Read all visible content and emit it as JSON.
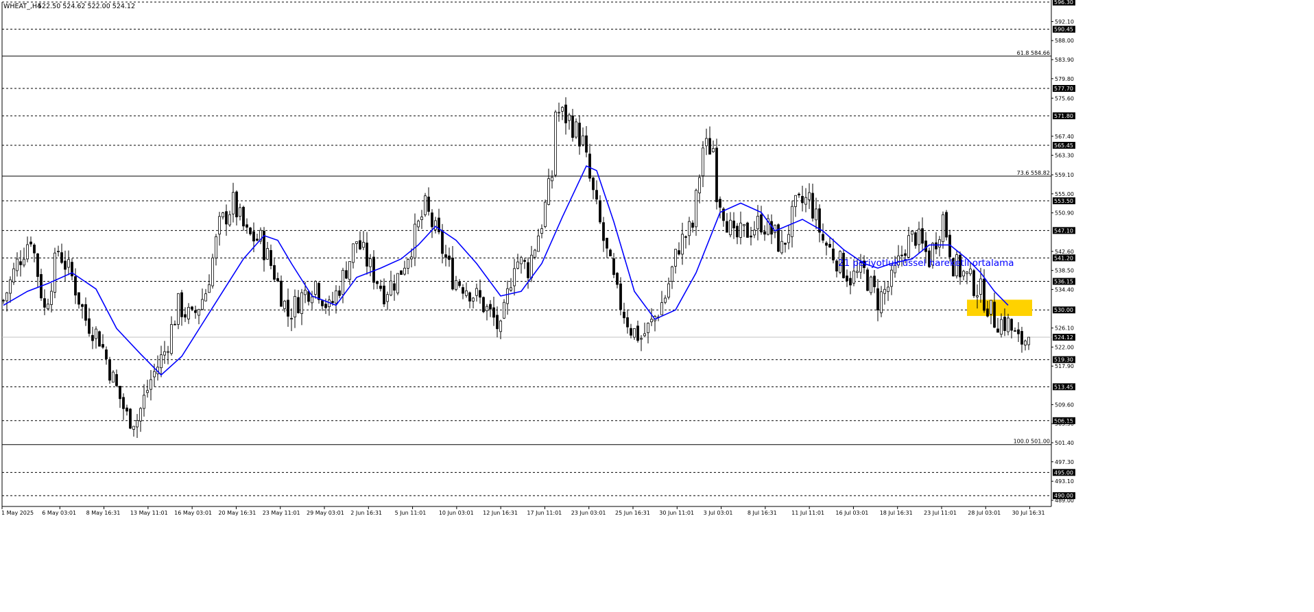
{
  "chart_header": {
    "symbol": "WHEAT_,H4",
    "ohlc": "522.50 524.62 522.00 524.12"
  },
  "annotation": "21 periyotluk üssel hareketli ortalama",
  "colors": {
    "background": "#ffffff",
    "candle": "#000000",
    "ema": "#0000ff",
    "highlight": "#ffd200",
    "annotation_text": "#0000ff"
  },
  "chart_data": {
    "type": "line",
    "subtype": "candlestick",
    "title": "",
    "xlabel": "",
    "ylabel": "",
    "ylim": [
      489.0,
      596.3
    ],
    "grid": false,
    "y_ticks": [
      "592.10",
      "588.00",
      "583.90",
      "579.80",
      "575.60",
      "567.40",
      "563.30",
      "559.10",
      "555.00",
      "550.90",
      "542.60",
      "538.50",
      "534.40",
      "526.10",
      "522.00",
      "517.90",
      "509.60",
      "505.50",
      "501.40",
      "497.30",
      "493.10",
      "489.00"
    ],
    "x_ticks": [
      "1 May 2025",
      "6 May 03:01",
      "8 May 16:31",
      "13 May 11:01",
      "16 May 03:01",
      "20 May 16:31",
      "23 May 11:01",
      "29 May 03:01",
      "2 Jun 16:31",
      "5 Jun 11:01",
      "10 Jun 03:01",
      "12 Jun 16:31",
      "17 Jun 11:01",
      "23 Jun 03:01",
      "25 Jun 16:31",
      "30 Jun 11:01",
      "3 Jul 03:01",
      "8 Jul 16:31",
      "11 Jul 11:01",
      "16 Jul 03:01",
      "18 Jul 16:31",
      "23 Jul 11:01",
      "28 Jul 03:01",
      "30 Jul 16:31"
    ],
    "horizontal_levels": [
      {
        "value": 596.3,
        "label": "596.30",
        "style": "dashed"
      },
      {
        "value": 590.45,
        "label": "590.45",
        "style": "dashed"
      },
      {
        "value": 584.66,
        "label": "61.8 584.66",
        "style": "solid",
        "fib": true
      },
      {
        "value": 577.7,
        "label": "577.70",
        "style": "dashed"
      },
      {
        "value": 571.8,
        "label": "571.80",
        "style": "dashed"
      },
      {
        "value": 565.45,
        "label": "565.45",
        "style": "dashed"
      },
      {
        "value": 558.82,
        "label": "73.6 558.82",
        "style": "solid",
        "fib": true
      },
      {
        "value": 553.5,
        "label": "553.50",
        "style": "dashed"
      },
      {
        "value": 547.1,
        "label": "547.10",
        "style": "dashed"
      },
      {
        "value": 541.2,
        "label": "541.20",
        "style": "dashed"
      },
      {
        "value": 536.15,
        "label": "536.15",
        "style": "dashed"
      },
      {
        "value": 530.0,
        "label": "530.00",
        "style": "dashed"
      },
      {
        "value": 524.12,
        "label": "524.12",
        "style": "current"
      },
      {
        "value": 519.3,
        "label": "519.30",
        "style": "dashed"
      },
      {
        "value": 513.45,
        "label": "513.45",
        "style": "dashed"
      },
      {
        "value": 506.15,
        "label": "506.15",
        "style": "dashed"
      },
      {
        "value": 501.0,
        "label": "100.0 501.00",
        "style": "solid",
        "fib": true
      },
      {
        "value": 495.0,
        "label": "495.00",
        "style": "dashed"
      },
      {
        "value": 490.0,
        "label": "490.00",
        "style": "dashed"
      }
    ],
    "highlight_zone": {
      "y_from": 528.7,
      "y_to": 532.2,
      "x_from_bar": 281,
      "x_to_bar": 300
    },
    "price_path": [
      [
        0,
        532
      ],
      [
        4,
        540
      ],
      [
        8,
        546
      ],
      [
        12,
        530
      ],
      [
        16,
        543
      ],
      [
        20,
        537
      ],
      [
        24,
        528
      ],
      [
        28,
        524
      ],
      [
        32,
        515
      ],
      [
        36,
        507
      ],
      [
        39,
        506.5
      ],
      [
        43,
        515
      ],
      [
        47,
        521
      ],
      [
        51,
        531
      ],
      [
        55,
        528
      ],
      [
        59,
        534
      ],
      [
        63,
        548
      ],
      [
        67,
        553
      ],
      [
        71,
        546
      ],
      [
        75,
        545
      ],
      [
        79,
        538
      ],
      [
        83,
        529
      ],
      [
        87,
        533
      ],
      [
        91,
        536
      ],
      [
        95,
        530
      ],
      [
        99,
        537
      ],
      [
        103,
        545
      ],
      [
        107,
        539
      ],
      [
        111,
        534
      ],
      [
        115,
        537
      ],
      [
        119,
        544
      ],
      [
        123,
        552
      ],
      [
        127,
        545
      ],
      [
        131,
        537
      ],
      [
        135,
        535
      ],
      [
        139,
        532
      ],
      [
        143,
        528
      ],
      [
        145,
        525
      ],
      [
        149,
        541
      ],
      [
        153,
        539
      ],
      [
        157,
        549
      ],
      [
        160,
        559
      ],
      [
        161,
        573
      ],
      [
        165,
        571
      ],
      [
        169,
        566
      ],
      [
        171,
        558
      ],
      [
        175,
        545
      ],
      [
        179,
        533
      ],
      [
        183,
        526
      ],
      [
        186,
        524
      ],
      [
        189,
        527
      ],
      [
        193,
        533
      ],
      [
        197,
        544
      ],
      [
        201,
        548
      ],
      [
        204,
        565
      ],
      [
        207,
        565
      ],
      [
        208,
        556
      ],
      [
        213,
        545
      ],
      [
        217,
        547
      ],
      [
        221,
        549
      ],
      [
        225,
        546
      ],
      [
        227,
        543
      ],
      [
        231,
        552
      ],
      [
        235,
        554
      ],
      [
        239,
        545
      ],
      [
        243,
        541
      ],
      [
        247,
        537
      ],
      [
        251,
        538
      ],
      [
        255,
        532
      ],
      [
        259,
        536
      ],
      [
        263,
        544
      ],
      [
        266,
        546
      ],
      [
        270,
        541
      ],
      [
        274,
        550
      ],
      [
        277,
        540
      ],
      [
        281,
        537
      ],
      [
        285,
        534
      ],
      [
        289,
        528
      ],
      [
        293,
        527
      ],
      [
        296,
        523
      ],
      [
        299,
        524.12
      ]
    ],
    "ema_path": [
      [
        0,
        531
      ],
      [
        7,
        534
      ],
      [
        13,
        535.7
      ],
      [
        20,
        538
      ],
      [
        27,
        534.5
      ],
      [
        33,
        526
      ],
      [
        40,
        520.5
      ],
      [
        46,
        516
      ],
      [
        52,
        520
      ],
      [
        58,
        527
      ],
      [
        64,
        534
      ],
      [
        70,
        541
      ],
      [
        76,
        546
      ],
      [
        80,
        545
      ],
      [
        84,
        540
      ],
      [
        90,
        533
      ],
      [
        97,
        531
      ],
      [
        103,
        537
      ],
      [
        110,
        539
      ],
      [
        116,
        541
      ],
      [
        121,
        544
      ],
      [
        126,
        548
      ],
      [
        132,
        545
      ],
      [
        138,
        540
      ],
      [
        145,
        533
      ],
      [
        151,
        534
      ],
      [
        157,
        540
      ],
      [
        163,
        550
      ],
      [
        170,
        561
      ],
      [
        173,
        560
      ],
      [
        178,
        549
      ],
      [
        184,
        534
      ],
      [
        190,
        528
      ],
      [
        196,
        530
      ],
      [
        202,
        538
      ],
      [
        209,
        551
      ],
      [
        215,
        553
      ],
      [
        221,
        551
      ],
      [
        225,
        547
      ],
      [
        233,
        549.5
      ],
      [
        239,
        547
      ],
      [
        245,
        543
      ],
      [
        251,
        540
      ],
      [
        255,
        539
      ],
      [
        259,
        540
      ],
      [
        265,
        541
      ],
      [
        270,
        544
      ],
      [
        276,
        544
      ],
      [
        281,
        541
      ],
      [
        285,
        538
      ],
      [
        289,
        534
      ],
      [
        293,
        531
      ]
    ]
  }
}
